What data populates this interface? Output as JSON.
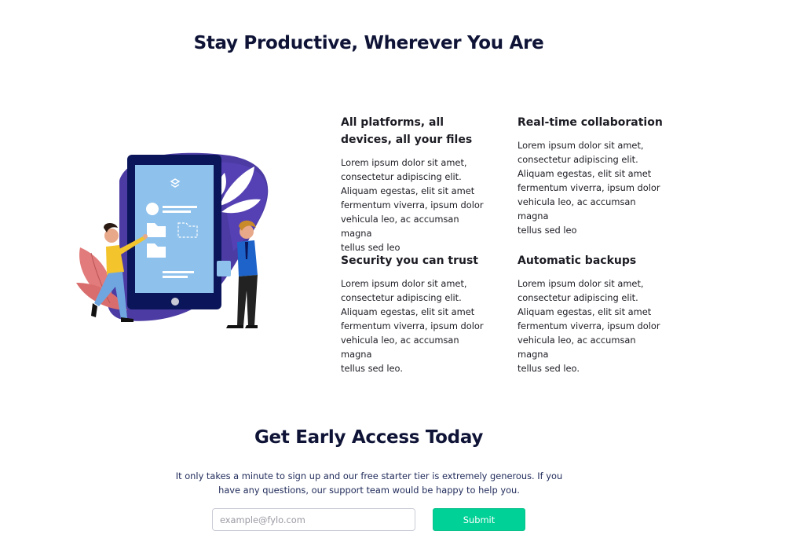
{
  "productive": {
    "title": "Stay Productive, Wherever You Are",
    "illustration_icon": "phone-collaboration-illustration",
    "features": [
      {
        "title": "All platforms, all devices, all your files",
        "text": "Lorem ipsum dolor sit amet,\nconsectetur adipiscing elit.\nAliquam egestas, elit sit amet\nfermentum viverra, ipsum dolor\nvehicula leo, ac accumsan magna\ntellus sed leo"
      },
      {
        "title": "Real-time collaboration",
        "text": "Lorem ipsum dolor sit amet,\nconsectetur adipiscing elit.\nAliquam egestas, elit sit amet\nfermentum viverra, ipsum dolor\nvehicula leo, ac accumsan magna\ntellus sed leo"
      },
      {
        "title": "Security you can trust",
        "text": "Lorem ipsum dolor sit amet,\nconsectetur adipiscing elit.\nAliquam egestas, elit sit amet\nfermentum viverra, ipsum dolor\nvehicula leo, ac accumsan magna\ntellus sed leo."
      },
      {
        "title": "Automatic backups",
        "text": "Lorem ipsum dolor sit amet,\nconsectetur adipiscing elit.\nAliquam egestas, elit sit amet\nfermentum viverra, ipsum dolor\nvehicula leo, ac accumsan magna\ntellus sed leo."
      }
    ]
  },
  "early_access": {
    "title": "Get Early Access Today",
    "text": "It only takes a minute to sign up and our free starter tier is extremely generous. If you have any questions, our support team would be happy to help you.",
    "email_placeholder": "example@fylo.com",
    "submit_label": "Submit"
  },
  "colors": {
    "heading": "#0f1437",
    "accent": "#00d196",
    "phone_body": "#0b1559",
    "phone_screen": "#8ec1ec",
    "blob": "#4b3ba3"
  }
}
